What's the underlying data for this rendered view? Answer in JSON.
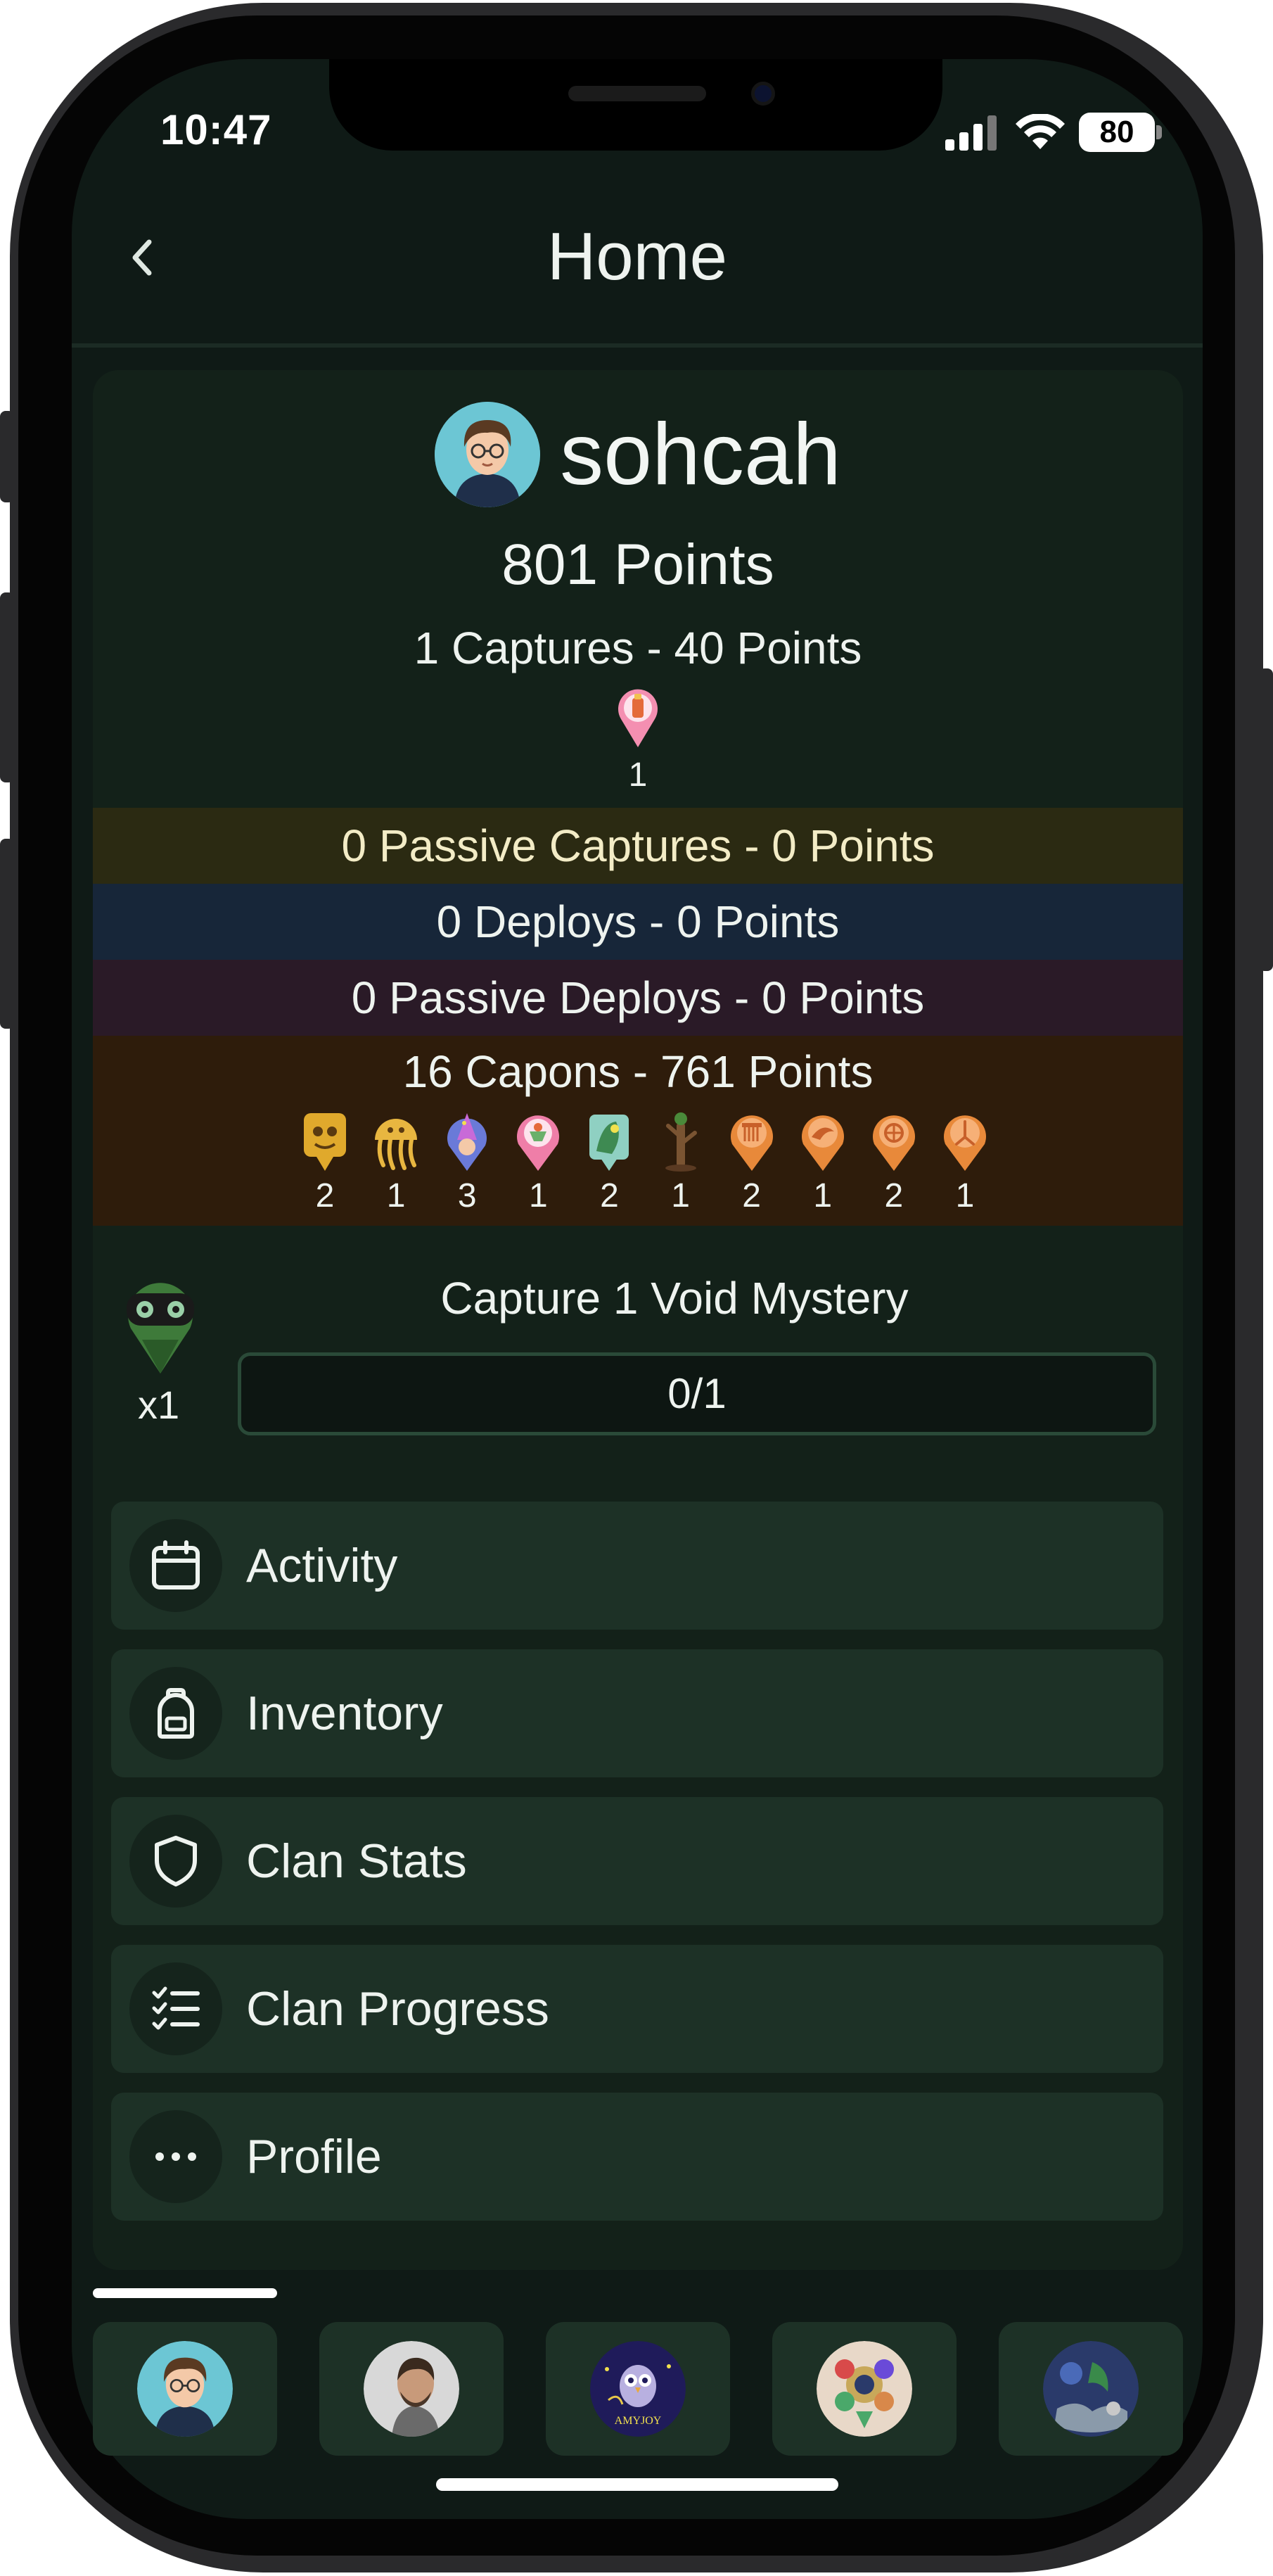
{
  "status_bar": {
    "time": "10:47",
    "battery": "80"
  },
  "header": {
    "title": "Home",
    "back_icon": "chevron-left-icon"
  },
  "user": {
    "name": "sohcah",
    "total_points": "801 Points"
  },
  "captures": {
    "label": "1 Captures - 40 Points",
    "pin_count": "1"
  },
  "passive_captures": {
    "label": "0 Passive Captures - 0 Points"
  },
  "deploys": {
    "label": "0 Deploys - 0 Points"
  },
  "passive_deploys": {
    "label": "0 Passive Deploys - 0 Points"
  },
  "capons": {
    "label": "16 Capons - 761 Points",
    "items": [
      {
        "icon": "capon-yellow-icon",
        "count": "2",
        "color": "#e0a92c"
      },
      {
        "icon": "capon-jellyfish-icon",
        "count": "1",
        "color": "#e8b640"
      },
      {
        "icon": "capon-wizard-icon",
        "count": "3",
        "color": "#6a7ad8"
      },
      {
        "icon": "capon-pink-icon",
        "count": "1",
        "color": "#ef7ea8"
      },
      {
        "icon": "capon-green-icon",
        "count": "2",
        "color": "#6ab06a"
      },
      {
        "icon": "capon-tree-icon",
        "count": "1",
        "color": "#7a5432"
      },
      {
        "icon": "capon-orange-icon",
        "count": "2",
        "color": "#e8893a"
      },
      {
        "icon": "capon-orange-icon",
        "count": "1",
        "color": "#e8893a"
      },
      {
        "icon": "capon-orange-icon",
        "count": "2",
        "color": "#e8893a"
      },
      {
        "icon": "capon-orange-icon",
        "count": "1",
        "color": "#e8893a"
      }
    ]
  },
  "mission": {
    "title": "Capture 1 Void Mystery",
    "multiplier": "x1",
    "progress": "0/1",
    "progress_fraction": 0
  },
  "menu": [
    {
      "label": "Activity",
      "icon": "calendar-icon"
    },
    {
      "label": "Inventory",
      "icon": "backpack-icon"
    },
    {
      "label": "Clan Stats",
      "icon": "shield-icon"
    },
    {
      "label": "Clan Progress",
      "icon": "checklist-icon"
    },
    {
      "label": "Profile",
      "icon": "more-icon"
    }
  ],
  "tabs": [
    {
      "name": "sohcah",
      "active": true
    },
    {
      "name": "user-2",
      "active": false
    },
    {
      "name": "AMYJOY",
      "active": false
    },
    {
      "name": "user-4",
      "active": false
    },
    {
      "name": "user-5",
      "active": false
    }
  ],
  "tab_label_amyjoy": "AMYJOY",
  "colors": {
    "background": "#0f1a16",
    "card": "#132119",
    "menu_item": "#1d3126",
    "passive_band": "#2b2a12",
    "deploy_band": "#172639",
    "passive_deploy_band": "#2a1a27",
    "capon_band": "#2e1c0b"
  }
}
